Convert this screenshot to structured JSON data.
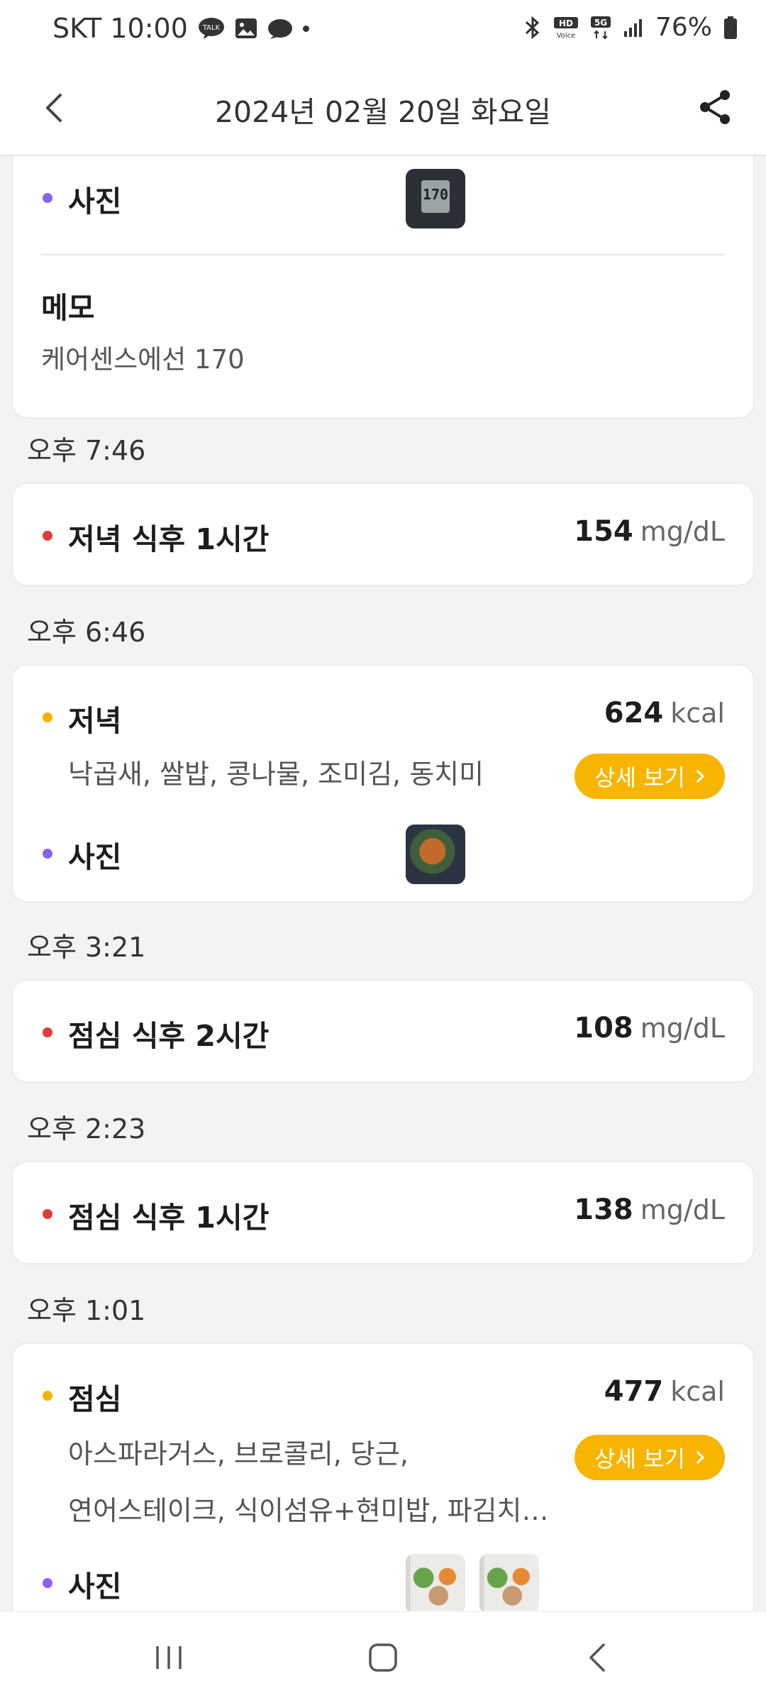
{
  "status_bar": {
    "carrier_time": "SKT 10:00",
    "battery": "76%",
    "network": "5G",
    "hd_voice": "HD Voice"
  },
  "header": {
    "title": "2024년 02월 20일 화요일"
  },
  "entries": {
    "photo_label": "사진",
    "memo_label": "메모",
    "memo_text": "케어센스에선 170",
    "meter_reading": "170",
    "e1": {
      "time": "오후 7:46",
      "label": "저녁 식후 1시간",
      "value": "154",
      "unit": "mg/dL"
    },
    "e2": {
      "time": "오후 6:46",
      "label": "저녁",
      "value": "624",
      "unit": "kcal",
      "foods": "낙곱새, 쌀밥, 콩나물, 조미김, 동치미",
      "detail": "상세 보기"
    },
    "e3": {
      "time": "오후 3:21",
      "label": "점심 식후 2시간",
      "value": "108",
      "unit": "mg/dL"
    },
    "e4": {
      "time": "오후 2:23",
      "label": "점심 식후 1시간",
      "value": "138",
      "unit": "mg/dL"
    },
    "e5": {
      "time": "오후 1:01",
      "label": "점심",
      "value": "477",
      "unit": "kcal",
      "foods_line1": "아스파라거스, 브로콜리, 당근,",
      "foods_line2": "연어스테이크, 식이섬유+현미밥, 파김치…",
      "detail": "상세 보기"
    }
  },
  "colors": {
    "accent_orange": "#f7b500",
    "glucose_red": "#e23b3b",
    "photo_purple": "#8c62f0",
    "meal_orange": "#f6b400"
  },
  "icons": {
    "back": "chevron-left-icon",
    "share": "share-icon",
    "detail": "chevron-right-icon"
  }
}
